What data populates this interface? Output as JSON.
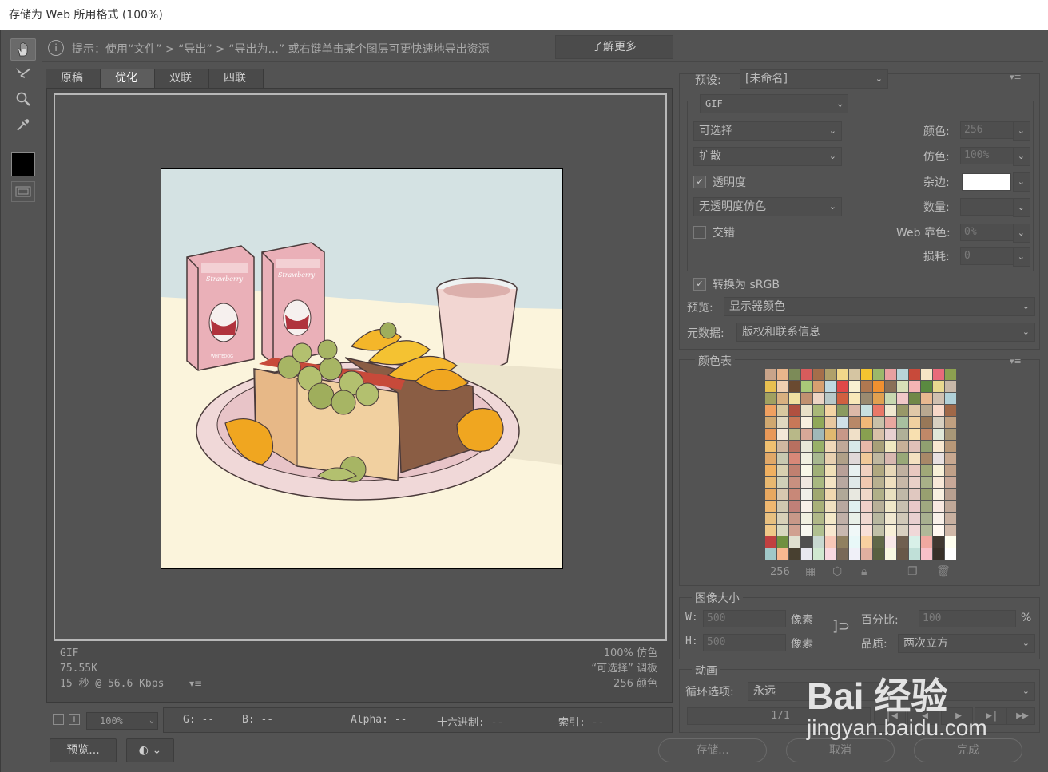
{
  "window": {
    "title": "存储为 Web 所用格式 (100%)"
  },
  "tip": {
    "text": "提示：使用“文件” > “导出” > “导出为...” 或右键单击某个图层可更快速地导出资源",
    "learn_more": "了解更多"
  },
  "tabs": [
    "原稿",
    "优化",
    "双联",
    "四联"
  ],
  "image_info": {
    "format": "GIF",
    "size": "75.55K",
    "speed": "15 秒 @ 56.6 Kbps",
    "dither": "100% 仿色",
    "palette": "“可选择” 调板",
    "colors": "256 颜色"
  },
  "zoom": {
    "value": "100%"
  },
  "pixel_info": {
    "g": "G: --",
    "b": "B: --",
    "alpha": "Alpha: --",
    "hex": "十六进制: --",
    "index": "索引: --"
  },
  "buttons": {
    "preview": "预览...",
    "save": "存储...",
    "cancel": "取消",
    "done": "完成"
  },
  "settings": {
    "preset_label": "预设:",
    "preset_value": "[未命名]",
    "format": "GIF",
    "reduction": "可选择",
    "dither_algo": "扩散",
    "transparency_label": "透明度",
    "transparency_dither": "无透明度仿色",
    "interlaced_label": "交错",
    "colors_label": "颜色:",
    "colors_value": "256",
    "dither_label": "仿色:",
    "dither_value": "100%",
    "matte_label": "杂边:",
    "amount_label": "数量:",
    "web_snap_label": "Web 靠色:",
    "web_snap_value": "0%",
    "lossy_label": "损耗:",
    "lossy_value": "0",
    "convert_srgb": "转换为 sRGB",
    "preview_label": "预览:",
    "preview_value": "显示器颜色",
    "metadata_label": "元数据:",
    "metadata_value": "版权和联系信息"
  },
  "color_table": {
    "title": "颜色表",
    "count": "256"
  },
  "image_size": {
    "title": "图像大小",
    "w_label": "W:",
    "w_value": "500",
    "h_label": "H:",
    "h_value": "500",
    "unit": "像素",
    "percent_label": "百分比:",
    "percent_value": "100",
    "percent_unit": "%",
    "quality_label": "品质:",
    "quality_value": "两次立方"
  },
  "animation": {
    "title": "动画",
    "loop_label": "循环选项:",
    "loop_value": "永远",
    "frame_counter": "1/1"
  },
  "artwork": {
    "carton_brand": "Strawberry",
    "carton_sub": "WHITEDOG"
  },
  "watermark": {
    "brand": "Bai 经验",
    "url": "jingyan.baidu.com"
  },
  "palette_colors": [
    "#c9a48a",
    "#e9b58b",
    "#7c8b58",
    "#d85c5c",
    "#a56e4a",
    "#b0a06a",
    "#f2d78a",
    "#d5c5a2",
    "#f4c430",
    "#9bb86a",
    "#e8a0a0",
    "#b8d4d8",
    "#c84a3a",
    "#f5e5c5",
    "#e86a7a",
    "#8ca050",
    "#e8c050",
    "#f0d0b0",
    "#6a4a30",
    "#a8c878",
    "#d8a070",
    "#c0d8e0",
    "#e04848",
    "#f8f0d0",
    "#b07850",
    "#f09030",
    "#8a7058",
    "#d8e0b8",
    "#f4b4b4",
    "#5a8a40",
    "#e8d890",
    "#c8b8a8",
    "#a0a060",
    "#d8b080",
    "#f0e0a0",
    "#c09070",
    "#ecd4c4",
    "#b8c8c8",
    "#d06040",
    "#f8e8b8",
    "#9a8a70",
    "#e0a050",
    "#c8d8b0",
    "#f0c8c8",
    "#708848",
    "#e8b890",
    "#d0c0b0",
    "#b0d0d8",
    "#f0a060",
    "#d8c8a0",
    "#b05040",
    "#e8e0c8",
    "#a8b878",
    "#f4d4a4",
    "#8a9a60",
    "#dcb8a8",
    "#c8e0e0",
    "#e87868",
    "#f0e8d0",
    "#989868",
    "#e0c8a8",
    "#b8a890",
    "#f8d8c8",
    "#a06848",
    "#d0a870",
    "#e0d8c0",
    "#c87858",
    "#f8f0e0",
    "#90a858",
    "#e8c8a0",
    "#d0e0e8",
    "#b88868",
    "#f0b878",
    "#c8c0a8",
    "#e8a8a0",
    "#a8c0a0",
    "#f0d0a0",
    "#987858",
    "#d8d0c0",
    "#c0a080",
    "#e89858",
    "#f4e8d8",
    "#b8b888",
    "#d8a898",
    "#a0b8b8",
    "#e0b870",
    "#c89888",
    "#f0e0c8",
    "#88a050",
    "#d8c0a8",
    "#e8d0d0",
    "#b0b098",
    "#f8e0b0",
    "#c08868",
    "#e0e8d8",
    "#a89878",
    "#f0c070",
    "#d0b8a0",
    "#b87060",
    "#e8e8d8",
    "#98b068",
    "#f0d8b8",
    "#c0a898",
    "#d8e8e8",
    "#e8b8a8",
    "#a8a078",
    "#f0e8c0",
    "#c8b098",
    "#e0c0b8",
    "#90a070",
    "#f8e8d0",
    "#b89878",
    "#e0a868",
    "#c8c8b0",
    "#d88878",
    "#f0f0e0",
    "#a8b890",
    "#e8d0b0",
    "#b0a088",
    "#e0d8d8",
    "#f0c898",
    "#c0b8a0",
    "#d8b8b0",
    "#98a878",
    "#f4e0c0",
    "#a88868",
    "#e8e0e0",
    "#c8a890",
    "#f0b060",
    "#d8d0b0",
    "#c08070",
    "#f8f8e8",
    "#a0b078",
    "#f0e0b8",
    "#b8a098",
    "#e8f0f0",
    "#f0d0c0",
    "#b0a880",
    "#e8d8b8",
    "#c0b0a0",
    "#e8c8c0",
    "#a0a878",
    "#f8f0d8",
    "#c0a088",
    "#e8b870",
    "#d0d0b8",
    "#c89080",
    "#f0e8e0",
    "#a8b880",
    "#f4e4c4",
    "#b8a8a0",
    "#e0e8e8",
    "#f0c8b0",
    "#b8b090",
    "#f0e0c0",
    "#c8b8a8",
    "#e8d0c8",
    "#a8b088",
    "#f8e8d8",
    "#c8a898",
    "#e8a860",
    "#d8c8b0",
    "#c88878",
    "#f0f0e8",
    "#a0a870",
    "#f0d8b0",
    "#b0a898",
    "#e8e8e0",
    "#f0d8c8",
    "#b0b088",
    "#e8e0c0",
    "#c0b8a8",
    "#e0c8c0",
    "#98a070",
    "#f8f0e0",
    "#b8a090",
    "#f0b870",
    "#d0c8b0",
    "#c08078",
    "#f8f0e8",
    "#a8b078",
    "#f0e0c0",
    "#b8a8a0",
    "#e0f0f0",
    "#f0d0c8",
    "#b8b098",
    "#f0e8c8",
    "#c8c0b0",
    "#e8c8c8",
    "#a0a880",
    "#f8e8e0",
    "#c0a898",
    "#e8c080",
    "#d8d0b8",
    "#c89888",
    "#f0f0e0",
    "#b0b888",
    "#f4e8c8",
    "#c0b0a8",
    "#e8f0e8",
    "#f0d8d0",
    "#b8b8a0",
    "#f0e8d0",
    "#d0c8b8",
    "#e8d0d0",
    "#a8b090",
    "#f8f0e8",
    "#c8b0a0",
    "#f0c888",
    "#d8d8c0",
    "#d0a090",
    "#f8f8f0",
    "#b0c090",
    "#f8e8d0",
    "#c8b8b0",
    "#f0f8f8",
    "#f8e0d8",
    "#c0c0a8",
    "#f8f0d8",
    "#d8d0c0",
    "#f0d8d8",
    "#b0b898",
    "#fff8f0",
    "#d0b8a8",
    "#c04040",
    "#709040",
    "#e0e0d0",
    "#505050",
    "#c8d8d0",
    "#f8c8b8",
    "#908060",
    "#e8f8f8",
    "#f8d0a0",
    "#606848",
    "#f8e8e8",
    "#706050",
    "#d8f0e8",
    "#f0a8a0",
    "#403830",
    "#fffff0",
    "#a0c8c8",
    "#f8b890",
    "#484030",
    "#e8e8f0",
    "#d0e8d0",
    "#f8d8e0",
    "#786858",
    "#f0f0f8",
    "#e0b0a0",
    "#586040",
    "#f8f8e0",
    "#685848",
    "#c0e0d8",
    "#f8c0c8",
    "#383028",
    "#ffffff"
  ]
}
